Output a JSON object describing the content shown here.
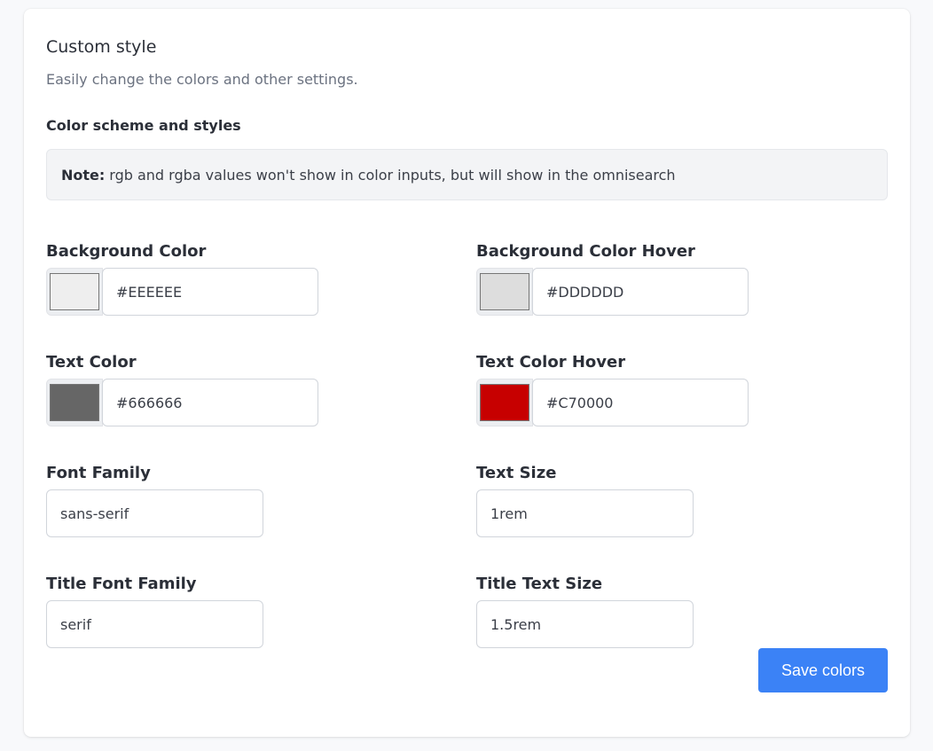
{
  "header": {
    "title": "Custom style",
    "subtitle": "Easily change the colors and other settings.",
    "section_heading": "Color scheme and styles"
  },
  "note": {
    "label": "Note:",
    "text": "rgb and rgba values won't show in color inputs, but will show in the omnisearch"
  },
  "fields": {
    "background_color": {
      "label": "Background Color",
      "value": "#EEEEEE",
      "swatch": "#eeeeee"
    },
    "background_color_hover": {
      "label": "Background Color Hover",
      "value": "#DDDDDD",
      "swatch": "#dddddd"
    },
    "text_color": {
      "label": "Text Color",
      "value": "#666666",
      "swatch": "#666666"
    },
    "text_color_hover": {
      "label": "Text Color Hover",
      "value": "#C70000",
      "swatch": "#c70000"
    },
    "font_family": {
      "label": "Font Family",
      "value": "sans-serif"
    },
    "text_size": {
      "label": "Text Size",
      "value": "1rem"
    },
    "title_font_family": {
      "label": "Title Font Family",
      "value": "serif"
    },
    "title_text_size": {
      "label": "Title Text Size",
      "value": "1.5rem"
    }
  },
  "actions": {
    "save_label": "Save colors"
  },
  "colors": {
    "accent": "#3b82f6"
  }
}
